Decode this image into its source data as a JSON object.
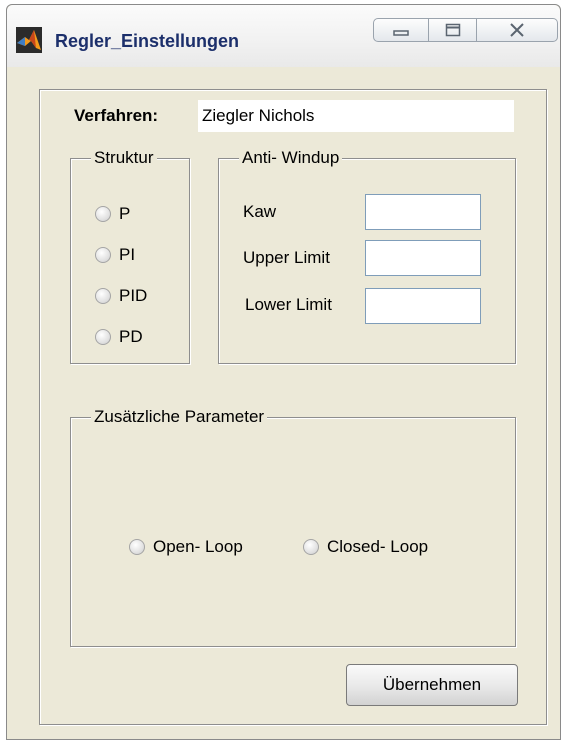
{
  "window": {
    "title": "Regler_Einstellungen",
    "icon": "matlab-icon",
    "controls": [
      "minimize-icon",
      "maximize-icon",
      "close-icon"
    ]
  },
  "verfahren": {
    "label": "Verfahren:",
    "value": "Ziegler Nichols"
  },
  "struktur": {
    "legend": "Struktur",
    "options": [
      "P",
      "PI",
      "PID",
      "PD"
    ]
  },
  "anti_windup": {
    "legend": "Anti- Windup",
    "fields": [
      {
        "label": "Kaw",
        "value": ""
      },
      {
        "label": "Upper Limit",
        "value": ""
      },
      {
        "label": "Lower Limit",
        "value": ""
      }
    ]
  },
  "zusaetzliche": {
    "legend": "Zusätzliche Parameter",
    "options": [
      "Open- Loop",
      "Closed- Loop"
    ]
  },
  "apply_button": {
    "label": "Übernehmen"
  }
}
